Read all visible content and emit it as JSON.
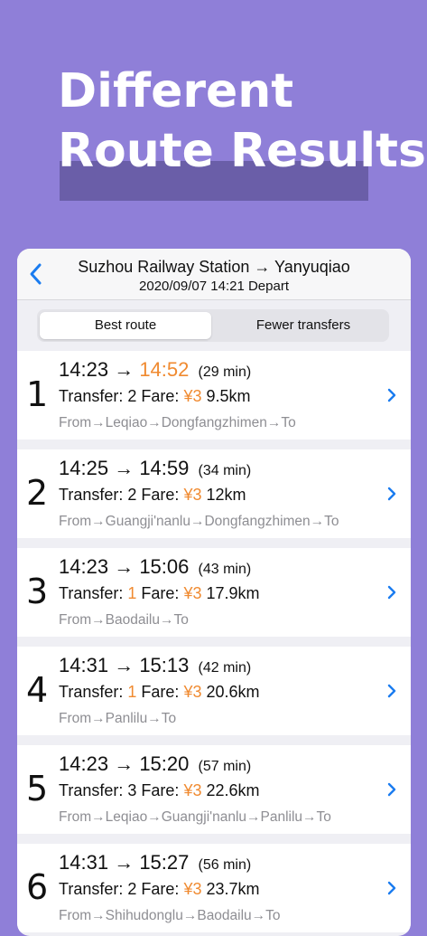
{
  "hero": {
    "line1": "Different",
    "line2": "Route Results"
  },
  "header": {
    "title": "Suzhou Railway Station → Yanyuqiao",
    "subtitle": "2020/09/07 14:21 Depart"
  },
  "tabs": [
    {
      "label": "Best route",
      "active": true
    },
    {
      "label": "Fewer transfers",
      "active": false
    }
  ],
  "labels": {
    "transfer": "Transfer:",
    "fare": "Fare:",
    "arrow": "→"
  },
  "colors": {
    "accent_orange": "#f08a30",
    "blue": "#1a7cf0",
    "background": "#8f7fd8"
  },
  "routes": [
    {
      "index": "1",
      "depart": "14:23",
      "arrive": "14:52",
      "arrive_highlight": true,
      "duration": "(29 min)",
      "transfers": "2",
      "transfers_highlight": false,
      "fare": "¥3",
      "distance": "9.5km",
      "via": "From→Leqiao→Dongfangzhimen→To"
    },
    {
      "index": "2",
      "depart": "14:25",
      "arrive": "14:59",
      "arrive_highlight": false,
      "duration": "(34 min)",
      "transfers": "2",
      "transfers_highlight": false,
      "fare": "¥3",
      "distance": "12km",
      "via": "From→Guangji'nanlu→Dongfangzhimen→To"
    },
    {
      "index": "3",
      "depart": "14:23",
      "arrive": "15:06",
      "arrive_highlight": false,
      "duration": "(43 min)",
      "transfers": "1",
      "transfers_highlight": true,
      "fare": "¥3",
      "distance": "17.9km",
      "via": "From→Baodailu→To"
    },
    {
      "index": "4",
      "depart": "14:31",
      "arrive": "15:13",
      "arrive_highlight": false,
      "duration": "(42 min)",
      "transfers": "1",
      "transfers_highlight": true,
      "fare": "¥3",
      "distance": "20.6km",
      "via": "From→Panlilu→To"
    },
    {
      "index": "5",
      "depart": "14:23",
      "arrive": "15:20",
      "arrive_highlight": false,
      "duration": "(57 min)",
      "transfers": "3",
      "transfers_highlight": false,
      "fare": "¥3",
      "distance": "22.6km",
      "via": "From→Leqiao→Guangji'nanlu→Panlilu→To"
    },
    {
      "index": "6",
      "depart": "14:31",
      "arrive": "15:27",
      "arrive_highlight": false,
      "duration": "(56 min)",
      "transfers": "2",
      "transfers_highlight": false,
      "fare": "¥3",
      "distance": "23.7km",
      "via": "From→Shihudonglu→Baodailu→To"
    }
  ]
}
